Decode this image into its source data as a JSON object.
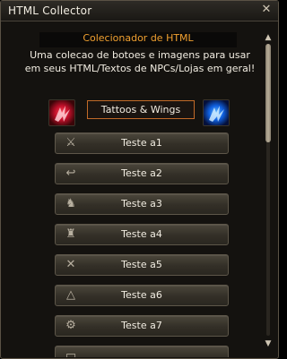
{
  "window": {
    "title": "HTML Collector"
  },
  "header": {
    "title": "Colecionador de HTML",
    "description_lines": [
      "Uma colecao de botoes e imagens para usar",
      "em seus HTML/Textos de NPCs/Lojas em geral!"
    ]
  },
  "section": {
    "label": "Tattoos & Wings"
  },
  "buttons": [
    {
      "label": "Teste a1",
      "icon": "crossed-swords-icon"
    },
    {
      "label": "Teste a2",
      "icon": "return-arrow-icon"
    },
    {
      "label": "Teste a3",
      "icon": "beast-icon"
    },
    {
      "label": "Teste a4",
      "icon": "boot-icon"
    },
    {
      "label": "Teste a5",
      "icon": "crossed-daggers-icon"
    },
    {
      "label": "Teste a6",
      "icon": "triangle-icon"
    },
    {
      "label": "Teste a7",
      "icon": "gear-icon"
    }
  ]
}
